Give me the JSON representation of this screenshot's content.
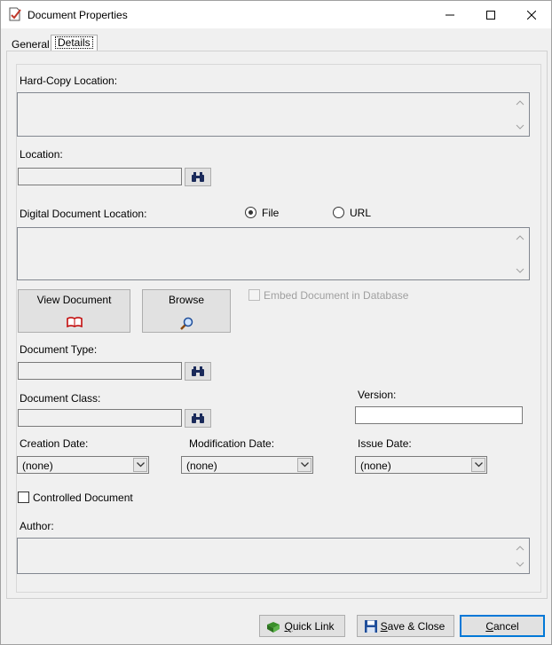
{
  "window": {
    "title": "Document Properties"
  },
  "tabs": [
    {
      "label": "General",
      "selected": false
    },
    {
      "label": "Details",
      "selected": true
    }
  ],
  "details": {
    "hardcopy_label": "Hard-Copy Location:",
    "location_label": "Location:",
    "digital_label": "Digital Document Location:",
    "radio_file": "File",
    "radio_url": "URL",
    "view_document": "View Document",
    "browse": "Browse",
    "embed_label": "Embed Document in Database",
    "document_type_label": "Document Type:",
    "document_class_label": "Document Class:",
    "version_label": "Version:",
    "creation_label": "Creation Date:",
    "modification_label": "Modification Date:",
    "issue_label": "Issue Date:",
    "creation_value": "(none)",
    "modification_value": "(none)",
    "issue_value": "(none)",
    "controlled_label": "Controlled Document",
    "author_label": "Author:"
  },
  "footer": {
    "quick_link_prefix": "Q",
    "quick_link_rest": "uick Link",
    "save_prefix": "S",
    "save_rest": "ave & Close",
    "cancel_prefix": "C",
    "cancel_rest": "ancel"
  },
  "colors": {
    "accent": "#0078d7",
    "book_icon": "#c00000",
    "quick_link_icon": "#3a8f2a",
    "save_icon": "#1f4e9a"
  }
}
